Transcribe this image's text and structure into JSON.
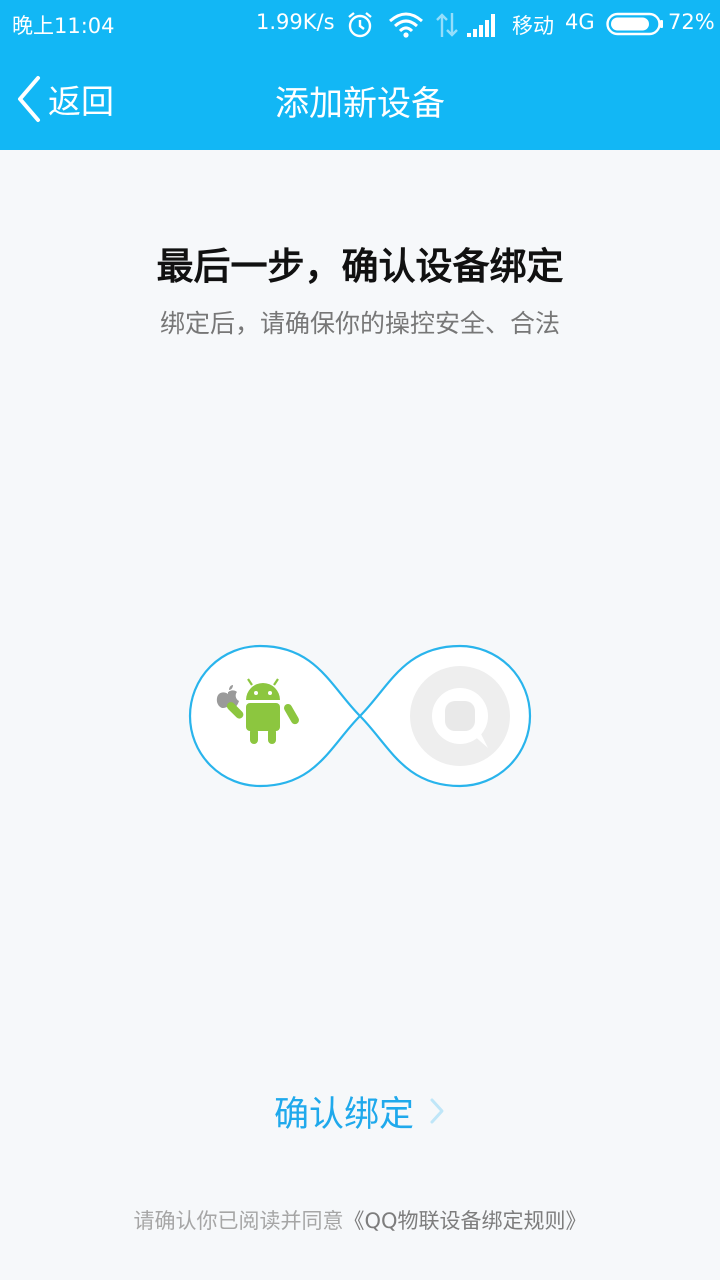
{
  "status_bar": {
    "time": "晚上11:04",
    "speed": "1.99K/s",
    "carrier": "移动",
    "network": "4G",
    "battery": "72%",
    "icons": [
      "alarm-icon",
      "wifi-icon",
      "data-arrows-icon",
      "signal-icon",
      "battery-icon"
    ]
  },
  "nav": {
    "back_label": "返回",
    "title": "添加新设备"
  },
  "main": {
    "headline": "最后一步，确认设备绑定",
    "subline": "绑定后，请确保你的操控安全、合法",
    "graphic": {
      "left_icon": "android-apple-icon",
      "right_icon": "qq-logo-icon",
      "connector": "infinity-loop"
    }
  },
  "confirm_label": "确认绑定",
  "agreement": {
    "prefix": "请确认你已阅读并同意",
    "link": "《QQ物联设备绑定规则》"
  },
  "colors": {
    "header_bg": "#12b7f5",
    "page_bg": "#f6f8fa",
    "accent": "#1fa9ec",
    "android_green": "#8cc63f"
  }
}
